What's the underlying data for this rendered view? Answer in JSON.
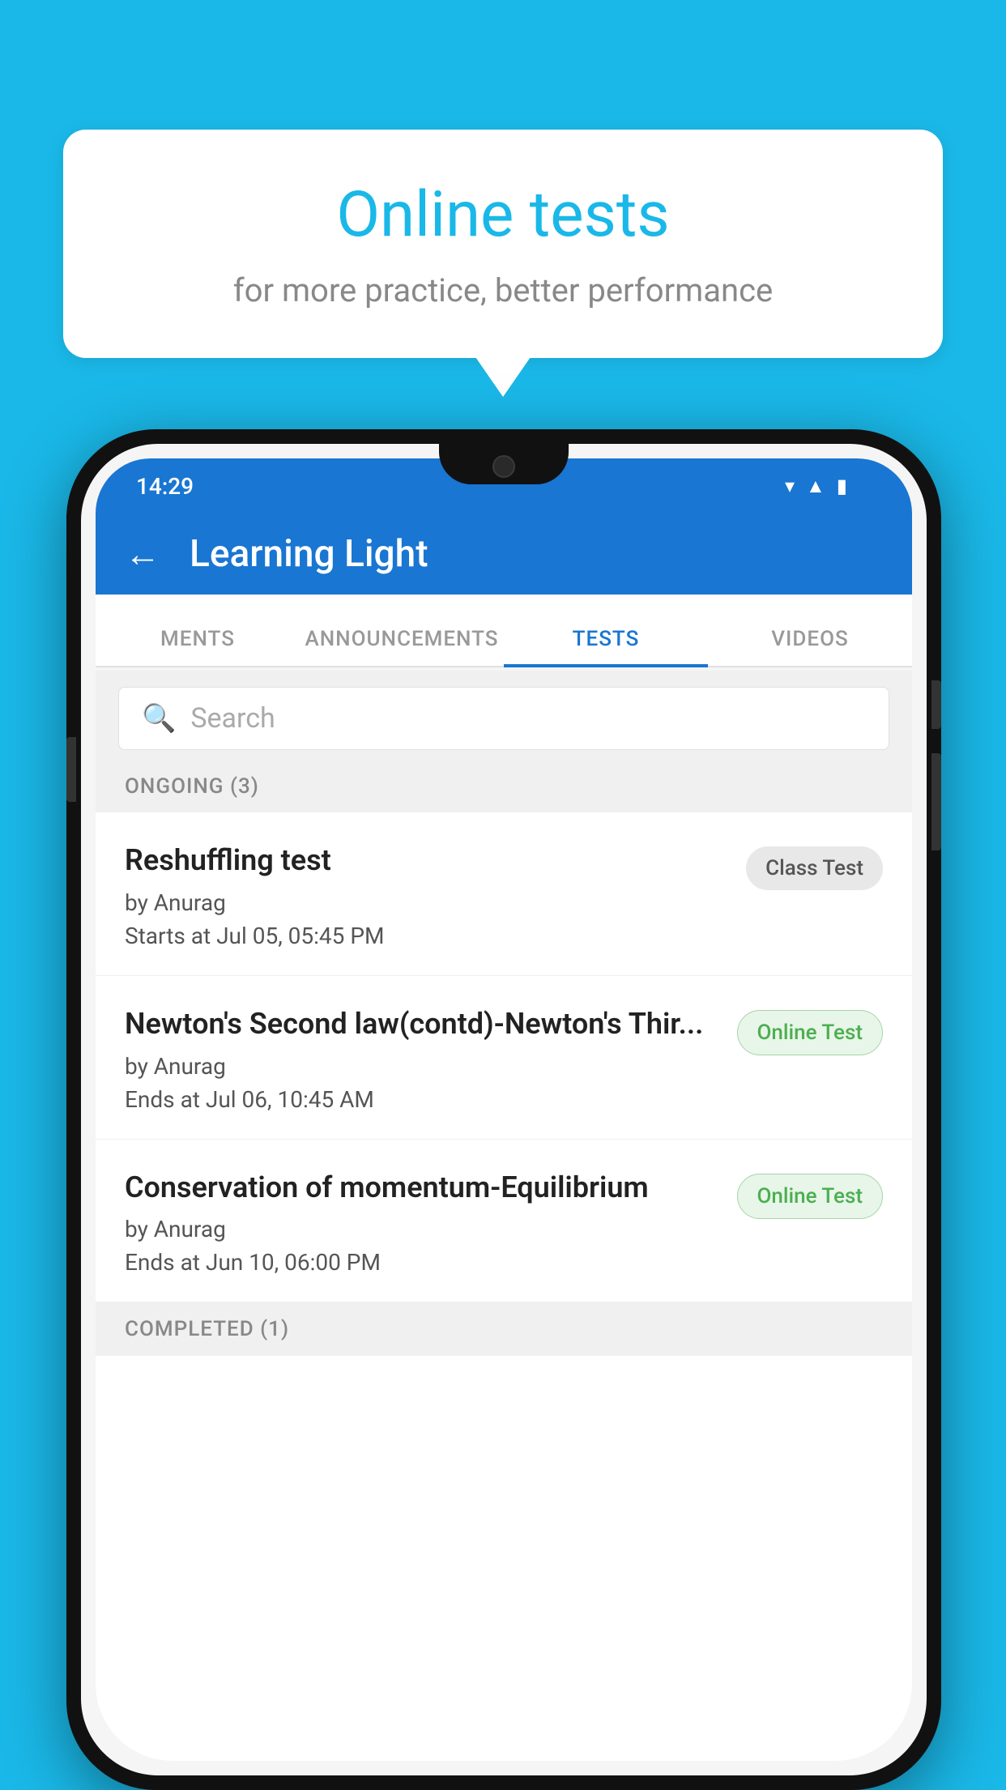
{
  "background_color": "#1ab8e8",
  "bubble": {
    "title": "Online tests",
    "subtitle": "for more practice, better performance"
  },
  "phone": {
    "status_bar": {
      "time": "14:29",
      "icons": [
        "wifi",
        "signal",
        "battery"
      ]
    },
    "app_bar": {
      "title": "Learning Light",
      "back_label": "←"
    },
    "tabs": [
      {
        "label": "MENTS",
        "active": false
      },
      {
        "label": "ANNOUNCEMENTS",
        "active": false
      },
      {
        "label": "TESTS",
        "active": true
      },
      {
        "label": "VIDEOS",
        "active": false
      }
    ],
    "search": {
      "placeholder": "Search",
      "icon": "🔍"
    },
    "section_ongoing": {
      "label": "ONGOING (3)"
    },
    "tests": [
      {
        "name": "Reshuffling test",
        "author": "by Anurag",
        "time_label": "Starts at  Jul 05, 05:45 PM",
        "badge": "Class Test",
        "badge_type": "class"
      },
      {
        "name": "Newton's Second law(contd)-Newton's Thir...",
        "author": "by Anurag",
        "time_label": "Ends at  Jul 06, 10:45 AM",
        "badge": "Online Test",
        "badge_type": "online"
      },
      {
        "name": "Conservation of momentum-Equilibrium",
        "author": "by Anurag",
        "time_label": "Ends at  Jun 10, 06:00 PM",
        "badge": "Online Test",
        "badge_type": "online"
      }
    ],
    "section_completed": {
      "label": "COMPLETED (1)"
    }
  }
}
